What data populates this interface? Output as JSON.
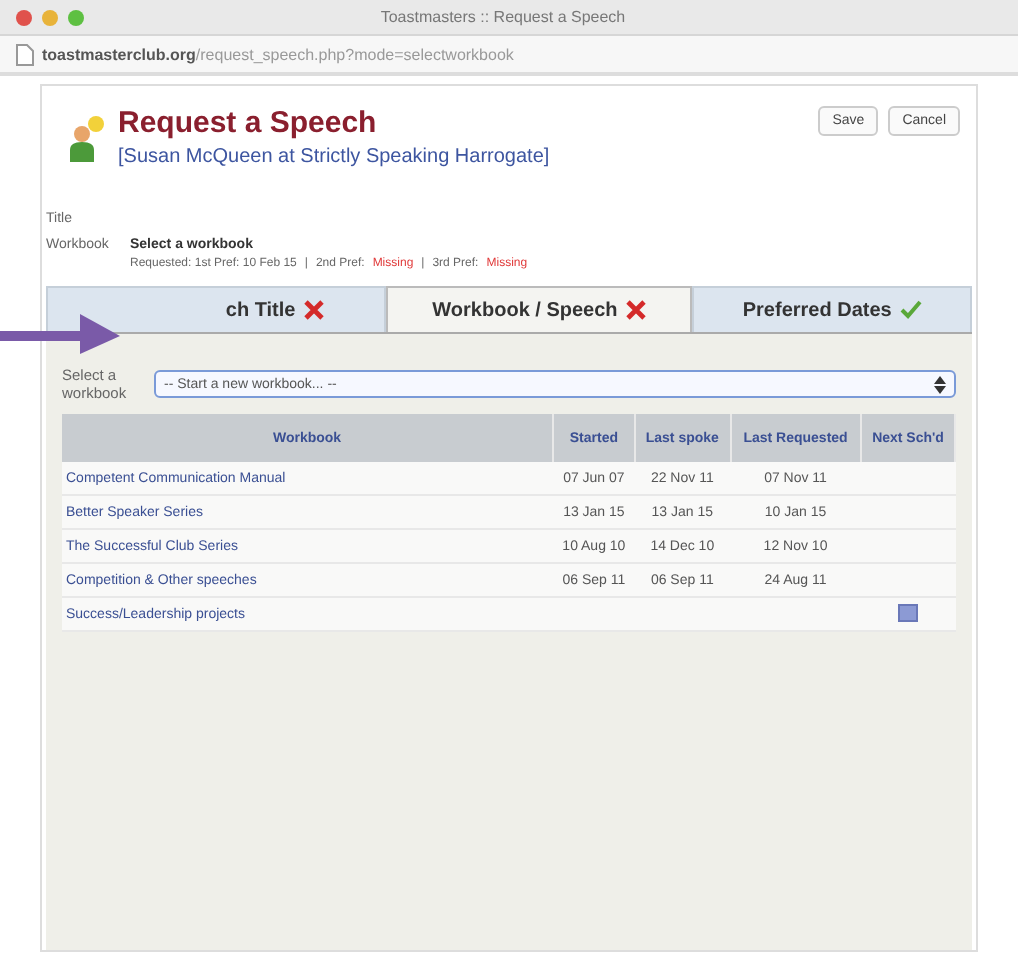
{
  "window": {
    "title": "Toastmasters :: Request a Speech"
  },
  "address_bar": {
    "domain": "toastmasterclub.org",
    "path": "/request_speech.php?mode=selectworkbook"
  },
  "header": {
    "title": "Request a Speech",
    "subtitle": "[Susan McQueen at Strictly Speaking Harrogate]",
    "buttons": [
      "Save",
      "Cancel"
    ]
  },
  "summary": [
    {
      "label": "Title"
    },
    {
      "label": "Workbook",
      "value": "Select a workbook",
      "details": [
        {
          "text": "Requested: 1st Pref: 10 Feb 15",
          "missing": false
        },
        {
          "text": "|",
          "missing": false
        },
        {
          "text": "2nd Pref:",
          "missing": false
        },
        {
          "text": "Missing",
          "missing": true
        },
        {
          "text": "|",
          "missing": false
        },
        {
          "text": "3rd Pref:",
          "missing": false
        },
        {
          "text": "Missing",
          "missing": true
        }
      ]
    }
  ],
  "tabs": [
    {
      "label": "ch Title",
      "complete": false,
      "selected": false
    },
    {
      "label": "Workbook / Speech",
      "complete": false,
      "selected": true
    },
    {
      "label": "Preferred Dates",
      "complete": true,
      "selected": false
    }
  ],
  "select": {
    "label": "Select a workbook",
    "value": "-- Start a new workbook... --"
  },
  "table": {
    "columns": [
      "Workbook",
      "Started",
      "Last spoke",
      "Last Requested",
      "Next Sch'd"
    ],
    "rows": [
      {
        "cells": [
          "Competent Communication Manual",
          "07 Jun 07",
          "22 Nov 11",
          "07 Nov 11"
        ],
        "scheduled": false
      },
      {
        "cells": [
          "Better Speaker Series",
          "13 Jan 15",
          "13 Jan 15",
          "10 Jan 15"
        ],
        "scheduled": false
      },
      {
        "cells": [
          "The Successful Club Series",
          "10 Aug 10",
          "14 Dec 10",
          "12 Nov 10"
        ],
        "scheduled": false
      },
      {
        "cells": [
          "Competition & Other speeches",
          "06 Sep 11",
          "06 Sep 11",
          "24 Aug 11"
        ],
        "scheduled": false
      },
      {
        "cells": [
          "Success/Leadership projects",
          "",
          "",
          ""
        ],
        "scheduled": true
      }
    ]
  }
}
